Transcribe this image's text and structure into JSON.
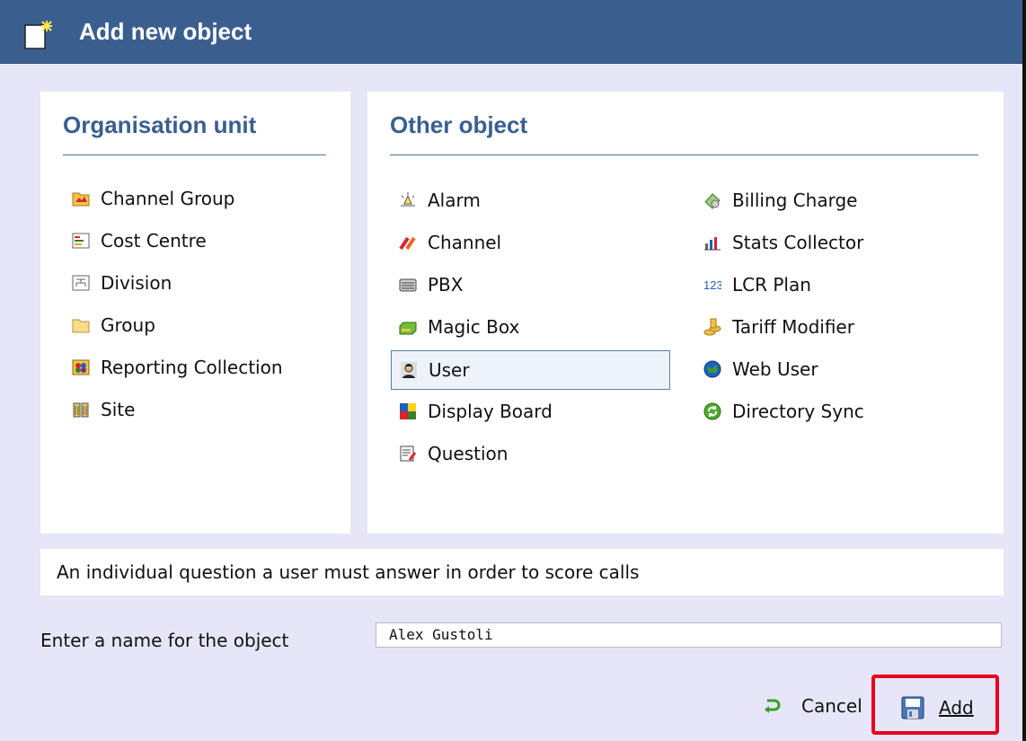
{
  "dialog": {
    "title": "Add new object"
  },
  "organisation_unit": {
    "heading": "Organisation unit",
    "items": [
      {
        "label": "Channel Group",
        "icon": "channel-group-icon"
      },
      {
        "label": "Cost Centre",
        "icon": "cost-centre-icon"
      },
      {
        "label": "Division",
        "icon": "division-icon"
      },
      {
        "label": "Group",
        "icon": "folder-icon"
      },
      {
        "label": "Reporting Collection",
        "icon": "reporting-collection-icon"
      },
      {
        "label": "Site",
        "icon": "site-icon"
      }
    ]
  },
  "other_object": {
    "heading": "Other object",
    "left_items": [
      {
        "label": "Alarm",
        "icon": "alarm-icon"
      },
      {
        "label": "Channel",
        "icon": "channel-icon"
      },
      {
        "label": "PBX",
        "icon": "pbx-icon"
      },
      {
        "label": "Magic Box",
        "icon": "magic-box-icon"
      },
      {
        "label": "User",
        "icon": "user-icon",
        "selected": true
      },
      {
        "label": "Display Board",
        "icon": "display-board-icon"
      },
      {
        "label": "Question",
        "icon": "question-icon"
      }
    ],
    "right_items": [
      {
        "label": "Billing Charge",
        "icon": "billing-charge-icon"
      },
      {
        "label": "Stats Collector",
        "icon": "stats-collector-icon"
      },
      {
        "label": "LCR Plan",
        "icon": "lcr-plan-icon"
      },
      {
        "label": "Tariff Modifier",
        "icon": "tariff-modifier-icon"
      },
      {
        "label": "Web User",
        "icon": "web-user-icon"
      },
      {
        "label": "Directory Sync",
        "icon": "directory-sync-icon"
      }
    ]
  },
  "description": "An individual question a user must answer in order to score calls",
  "name_field": {
    "label": "Enter a name for the object",
    "value": "Alex Gustoli"
  },
  "buttons": {
    "cancel": "Cancel",
    "add": "Add"
  },
  "colors": {
    "titlebar": "#3a5f8f",
    "body_bg": "#e6e6f8",
    "heading": "#3a5f8f",
    "highlight": "#e8001c"
  }
}
